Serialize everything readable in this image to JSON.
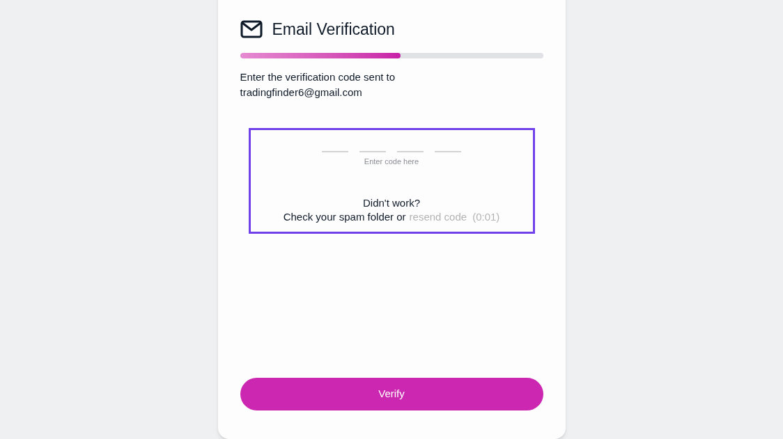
{
  "title": "Email Verification",
  "progress": {
    "level": 0.53
  },
  "instruction": "Enter the verification code sent to",
  "email": "tradingfinder6@gmail.com",
  "code_field": {
    "placeholder": "Enter code here"
  },
  "help": {
    "heading": "Didn't work?",
    "text": "Check your spam folder or",
    "resend_link": {
      "label": "resend code",
      "disabled": true
    },
    "timer": "(0:01)"
  },
  "verify_button": {
    "label": "Verify"
  }
}
